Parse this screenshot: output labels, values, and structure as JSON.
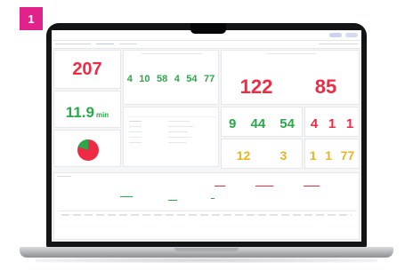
{
  "badge": {
    "number": "1"
  },
  "dashboard": {
    "panels": {
      "top_left_value": "207",
      "value_with_unit": "11.9",
      "unit": "min",
      "row_values": [
        "4",
        "10",
        "58",
        "4",
        "54",
        "77"
      ],
      "right_top_left": "122",
      "right_top_right": "85",
      "green_row": [
        "9",
        "44",
        "54"
      ],
      "red_row": [
        "4",
        "1",
        "1"
      ],
      "yellow_left": [
        "12",
        "3"
      ],
      "mixed_right": [
        "1",
        "1",
        "77"
      ]
    },
    "colors": {
      "red": "#ee2a44",
      "green": "#2aa84a",
      "yellow": "#e9b421",
      "badge": "#e0228a"
    },
    "pie": {
      "slices": [
        {
          "color": "#2aa84a",
          "fraction": 0.28
        },
        {
          "color": "#ee2a44",
          "fraction": 0.72
        }
      ]
    }
  }
}
